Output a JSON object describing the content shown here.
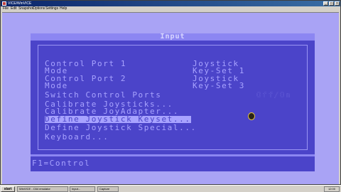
{
  "window": {
    "title": "VICE/WinVICE",
    "menu": [
      "File",
      "Edit",
      "Snapshot",
      "Options",
      "Settings",
      "Help"
    ]
  },
  "emulator": {
    "title": "Input",
    "items": [
      {
        "label": "Control Port 1",
        "sub": "Mode",
        "value1": "Joystick",
        "value2": "Key-Set 1"
      },
      {
        "label": "Control Port 2",
        "sub": "Mode",
        "value1": "Joystick",
        "value2": "Key-Set 3"
      },
      {
        "label": "Switch Control Ports",
        "value1": "Off/On"
      },
      {
        "label": "Calibrate Joysticks..."
      },
      {
        "label": "Calibrate JoyAdapter..."
      },
      {
        "label": "Define Joystick Keyset..."
      },
      {
        "label": "Define Joystick Special..."
      },
      {
        "label": "Keyboard..."
      }
    ],
    "footer": "F1=Control"
  },
  "taskbar": {
    "start": "start",
    "tasks": [
      "WinVICE - C64 emulator",
      "Input...",
      "Capture"
    ],
    "clock": "12:00"
  },
  "colors": {
    "c64_background": "#4b44c9",
    "c64_text": "#a8a3ff",
    "c64_border": "#a9a3f5"
  }
}
